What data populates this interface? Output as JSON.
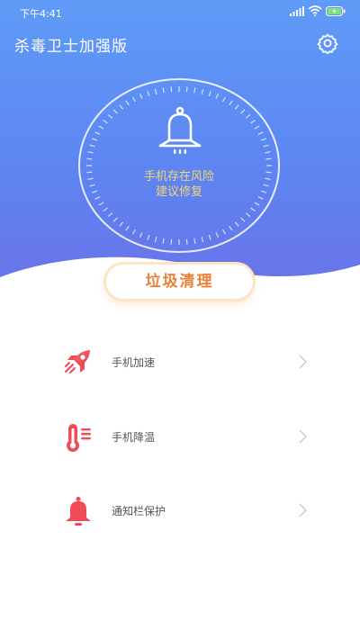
{
  "status_bar": {
    "time": "下午4:41"
  },
  "header": {
    "title": "杀毒卫士加强版",
    "settings_icon": "gear-icon"
  },
  "scan": {
    "line1": "手机存在风险",
    "line2": "建议修复",
    "icon": "bell-icon"
  },
  "clean_button": {
    "label": "垃圾清理"
  },
  "menu": [
    {
      "label": "手机加速",
      "icon": "rocket-icon"
    },
    {
      "label": "手机降温",
      "icon": "thermometer-icon"
    },
    {
      "label": "通知栏保护",
      "icon": "bell-icon"
    }
  ],
  "colors": {
    "hero_top": "#5f9bf7",
    "hero_bottom": "#6a72e8",
    "warning_text": "#f2d66f",
    "accent_orange": "#e8823a",
    "icon_red": "#f04b57"
  }
}
